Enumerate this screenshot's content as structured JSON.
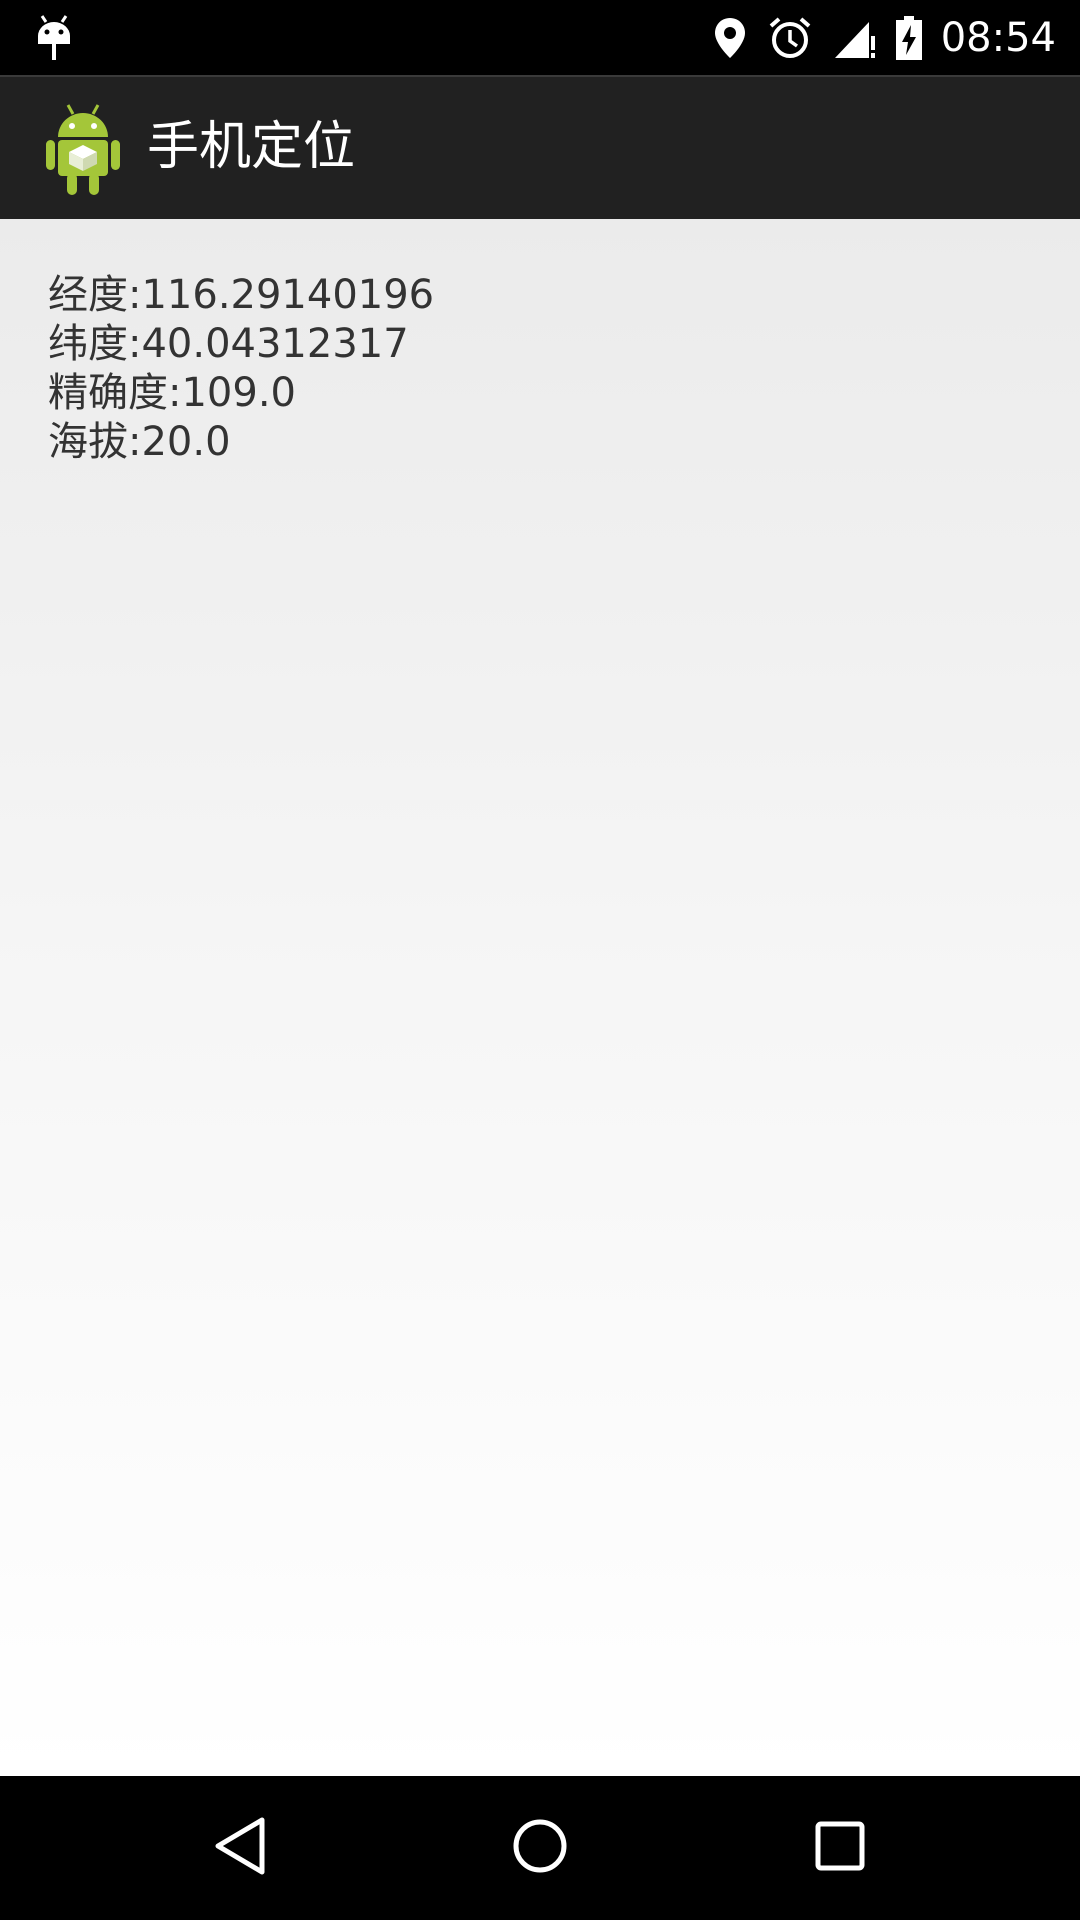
{
  "status_bar": {
    "time": "08:54",
    "icons": [
      "android-debug-icon",
      "location-pin-icon",
      "alarm-clock-icon",
      "signal-no-data-icon",
      "battery-charging-icon"
    ]
  },
  "action_bar": {
    "app_icon": "android-app-icon",
    "title": "手机定位"
  },
  "location": {
    "longitude": "经度:116.29140196",
    "latitude": "纬度:40.04312317",
    "accuracy": "精确度:109.0",
    "altitude": "海拔:20.0"
  },
  "nav_bar": {
    "icons": [
      "back-icon",
      "home-icon",
      "recents-icon"
    ]
  },
  "colors": {
    "status_bar_bg": "#000000",
    "action_bar_bg": "#212121",
    "text": "#333333",
    "android_green": "#a4c639"
  }
}
